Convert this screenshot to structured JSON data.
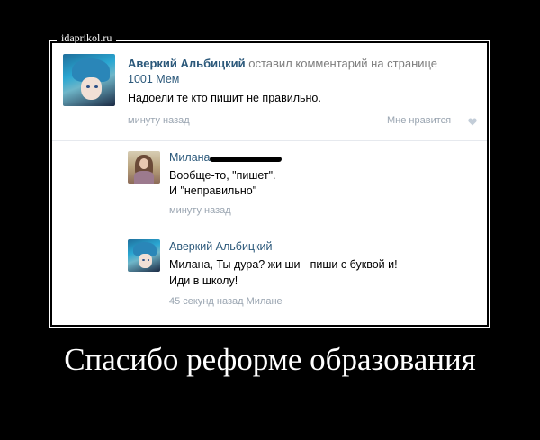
{
  "watermark": "idaprikol.ru",
  "post": {
    "author": "Аверкий Альбицкий",
    "action": "оставил комментарий на странице",
    "page": "1001 Мем",
    "text": "Надоели те кто пишит не правильно.",
    "time": "минуту назад",
    "like_label": "Мне нравится",
    "heart_icon": "heart-icon"
  },
  "replies": [
    {
      "author": "Милана",
      "author_redacted": true,
      "lines": [
        "Вообще-то, \"пишет\".",
        "И \"неправильно\""
      ],
      "time": "минуту назад"
    },
    {
      "author": "Аверкий Альбицкий",
      "lines": [
        "Милана, Ты дура? жи ши - пиши с буквой и!",
        "Иди в школу!"
      ],
      "time": "45 секунд назад Милане"
    }
  ],
  "caption": "Спасибо реформе образования",
  "colors": {
    "background": "#000000",
    "panel": "#ffffff",
    "link": "#2b587a",
    "meta": "#9aa5b1"
  }
}
